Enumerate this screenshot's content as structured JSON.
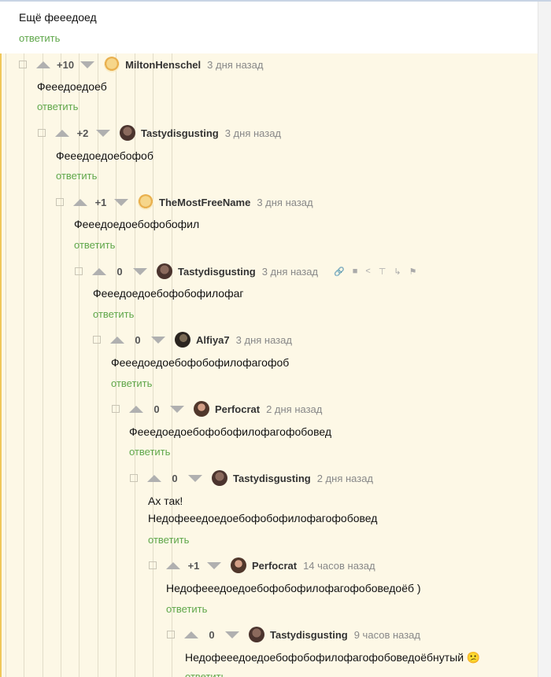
{
  "top_comment": {
    "text": "Ещё фееедоед",
    "reply": "ответить"
  },
  "comments": [
    {
      "rating": "+10",
      "user": "MiltonHenschel",
      "time": "3 дня назад",
      "text": "Фееедоедоеб",
      "reply": "ответить",
      "avatar": "dog"
    },
    {
      "rating": "+2",
      "user": "Tastydisgusting",
      "time": "3 дня назад",
      "text": "Фееедоедоебофоб",
      "reply": "ответить",
      "avatar": "brown"
    },
    {
      "rating": "+1",
      "user": "TheMostFreeName",
      "time": "3 дня назад",
      "text": "Фееедоедоебофобофил",
      "reply": "ответить",
      "avatar": "dog"
    },
    {
      "rating": "0",
      "user": "Tastydisgusting",
      "time": "3 дня назад",
      "text": "Фееедоедоебофобофилофаг",
      "reply": "ответить",
      "avatar": "brown",
      "tools": [
        "link-icon",
        "save-icon",
        "share-icon",
        "top-icon",
        "branch-icon",
        "flag-icon"
      ]
    },
    {
      "rating": "0",
      "user": "Alfiya7",
      "time": "3 дня назад",
      "text": "Фееедоедоебофобофилофагофоб",
      "reply": "ответить",
      "avatar": "dark"
    },
    {
      "rating": "0",
      "user": "Perfocrat",
      "time": "2 дня назад",
      "text": "Фееедоедоебофобофилофагофобовед",
      "reply": "ответить",
      "avatar": "man"
    },
    {
      "rating": "0",
      "user": "Tastydisgusting",
      "time": "2 дня назад",
      "text": "Ах так!\nНедофееедоедоебофобофилофагофобовед",
      "reply": "ответить",
      "avatar": "brown"
    },
    {
      "rating": "+1",
      "user": "Perfocrat",
      "time": "14 часов назад",
      "text": "Недофееедоедоебофобофилофагофобоведоёб )",
      "reply": "ответить",
      "avatar": "man"
    },
    {
      "rating": "0",
      "user": "Tastydisgusting",
      "time": "9 часов назад",
      "text": "Недофееедоедоебофобофилофагофобоведоёбнутый 😕",
      "reply": "ответить",
      "avatar": "brown"
    }
  ]
}
